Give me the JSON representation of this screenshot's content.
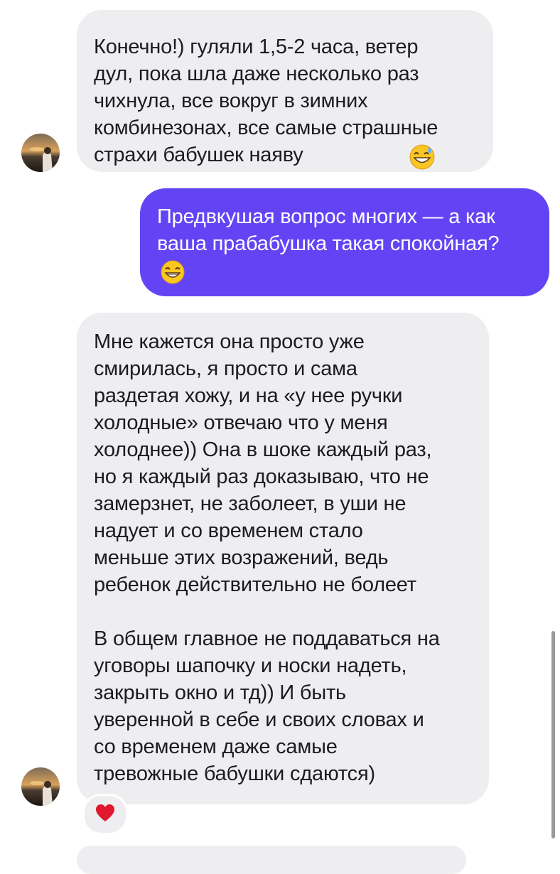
{
  "messages": [
    {
      "id": "msg1",
      "direction": "incoming",
      "text": "Конечно!) гуляли 1,5-2 часа, ветер\nдул, пока шла даже несколько раз\nчихнула, все вокруг в зимних\nкомбинезонах, все самые страшные\nстрахи бабушек наяву",
      "emoji": "grinning-sweat-emoji"
    },
    {
      "id": "msg2",
      "direction": "outgoing",
      "text": "Предвкушая вопрос многих — а как\nваша прабабушка такая спокойная?",
      "emoji": "grinning-emoji"
    },
    {
      "id": "msg3",
      "direction": "incoming",
      "text": "Мне кажется она просто уже\nсмирилась, я просто и сама\nраздетая хожу, и на «у нее ручки\nхолодные» отвечаю что у меня\nхолоднее)) Она в шоке каждый раз,\nно я каждый раз доказываю, что не\nзамерзнет, не заболеет, в уши не\nнадует и со временем стало\nменьше этих возражений, ведь\nребенок действительно не болеет\n\nВ общем главное не поддаваться на\nуговоры шапочку и носки надеть,\nзакрыть окно и тд)) И быть\nуверенной в себе и своих словах и\nсо временем даже самые\nтревожные бабушки сдаются)",
      "reaction": "red-heart-emoji"
    }
  ],
  "colors": {
    "incoming_bubble": "#eeeef0",
    "outgoing_bubble": "#6344f5",
    "outgoing_text": "#ffffff",
    "reaction_heart": "#e0182d"
  }
}
